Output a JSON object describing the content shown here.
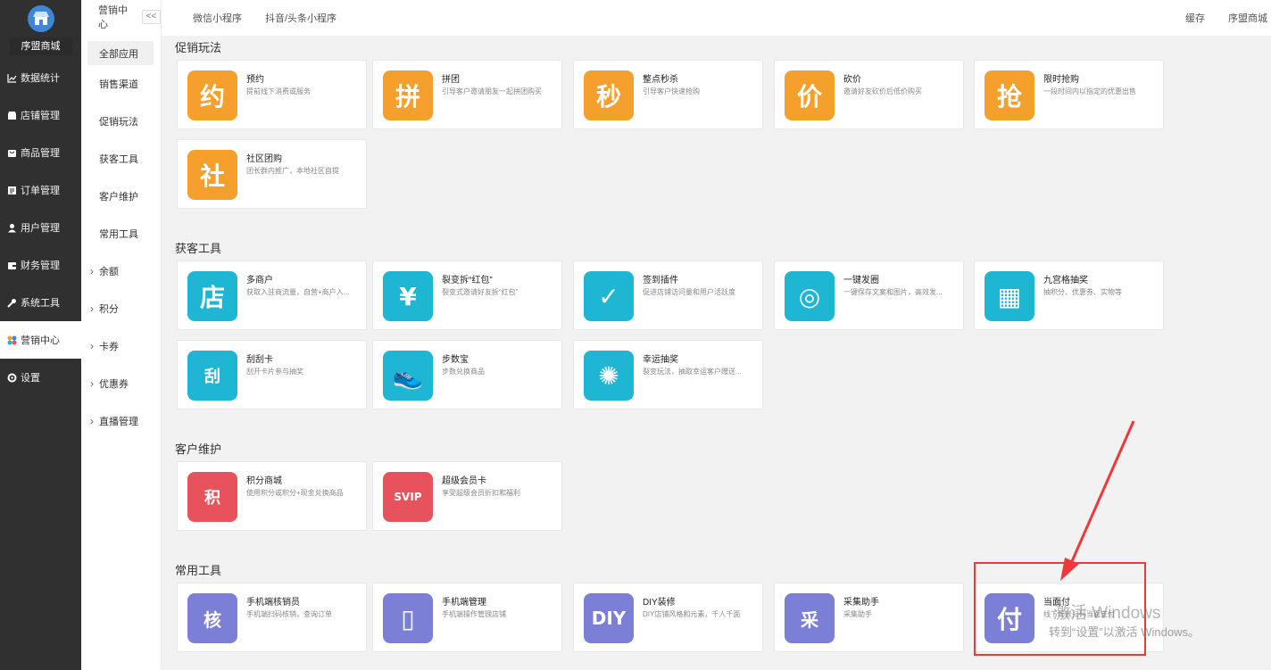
{
  "sidebar": {
    "shop_name": "序盟商城",
    "items": [
      {
        "label": "数据统计",
        "icon": "chart-icon"
      },
      {
        "label": "店铺管理",
        "icon": "shop-icon"
      },
      {
        "label": "商品管理",
        "icon": "goods-icon"
      },
      {
        "label": "订单管理",
        "icon": "order-icon"
      },
      {
        "label": "用户管理",
        "icon": "user-icon"
      },
      {
        "label": "财务管理",
        "icon": "finance-icon"
      },
      {
        "label": "系统工具",
        "icon": "wrench-icon"
      },
      {
        "label": "营销中心",
        "icon": "marketing-icon"
      },
      {
        "label": "设置",
        "icon": "settings-icon"
      }
    ]
  },
  "subnav": {
    "title": "营销中心",
    "collapse": "<<",
    "items": [
      "全部应用",
      "销售渠道",
      "促销玩法",
      "获客工具",
      "客户维护",
      "常用工具"
    ],
    "expandable": [
      "余额",
      "积分",
      "卡券",
      "优惠券",
      "直播管理"
    ]
  },
  "topbar": {
    "tabs": [
      "微信小程序",
      "抖音/头条小程序"
    ],
    "cache": "缓存",
    "shop": "序盟商城"
  },
  "sections": {
    "promo": {
      "title": "促销玩法",
      "cards": [
        {
          "name": "预约",
          "desc": "提前线下消费或服务",
          "glyph": "约"
        },
        {
          "name": "拼团",
          "desc": "引导客户邀请朋友一起拼团购买",
          "glyph": "拼"
        },
        {
          "name": "整点秒杀",
          "desc": "引导客户快速抢购",
          "glyph": "秒"
        },
        {
          "name": "砍价",
          "desc": "邀请好友砍价后低价购买",
          "glyph": "价"
        },
        {
          "name": "限时抢购",
          "desc": "一段时间内以指定的优惠出售",
          "glyph": "抢"
        },
        {
          "name": "社区团购",
          "desc": "团长群内推广，本地社区自提",
          "glyph": "社"
        }
      ]
    },
    "acquire": {
      "title": "获客工具",
      "cards": [
        {
          "name": "多商户",
          "desc": "获取入驻商流量，自营+商户入...",
          "glyph": "店"
        },
        {
          "name": "裂变拆“红包”",
          "desc": "裂变式邀请好友拆“红包”",
          "glyph": "¥"
        },
        {
          "name": "签到插件",
          "desc": "促进店铺访问量和用户活跃度",
          "glyph": "✓"
        },
        {
          "name": "一键发圈",
          "desc": "一键保存文案和图片，高效发...",
          "glyph": "◎"
        },
        {
          "name": "九宫格抽奖",
          "desc": "抽积分、优惠券、实物等",
          "glyph": "▦"
        },
        {
          "name": "刮刮卡",
          "desc": "刮开卡片参与抽奖",
          "glyph": "刮"
        },
        {
          "name": "步数宝",
          "desc": "步数兑换商品",
          "glyph": "👟"
        },
        {
          "name": "幸运抽奖",
          "desc": "裂变玩法，抽取幸运客户赠送...",
          "glyph": "✺"
        }
      ]
    },
    "retain": {
      "title": "客户维护",
      "cards": [
        {
          "name": "积分商城",
          "desc": "使用积分或积分+现金兑换商品",
          "glyph": "积"
        },
        {
          "name": "超级会员卡",
          "desc": "享受超级会员折扣和福利",
          "glyph": "SVIP"
        }
      ]
    },
    "common": {
      "title": "常用工具",
      "cards": [
        {
          "name": "手机端核销员",
          "desc": "手机端扫码核销，查询订单",
          "glyph": "核"
        },
        {
          "name": "手机端管理",
          "desc": "手机端操作管理店铺",
          "glyph": "▯"
        },
        {
          "name": "DIY装修",
          "desc": "DIY店铺风格和元素，千人千面",
          "glyph": "DIY"
        },
        {
          "name": "采集助手",
          "desc": "采集助手",
          "glyph": "采"
        },
        {
          "name": "当面付",
          "desc": "线下场景扫码当面支付",
          "glyph": "付"
        }
      ]
    }
  },
  "watermark": {
    "line1": "激活 Windows",
    "line2": "转到“设置”以激活 Windows。"
  },
  "colors": {
    "orange": "#f5a02c",
    "cyan": "#1fb6d4",
    "red": "#e8525c",
    "purple": "#7b7fd6",
    "annotation": "#f0383a"
  }
}
